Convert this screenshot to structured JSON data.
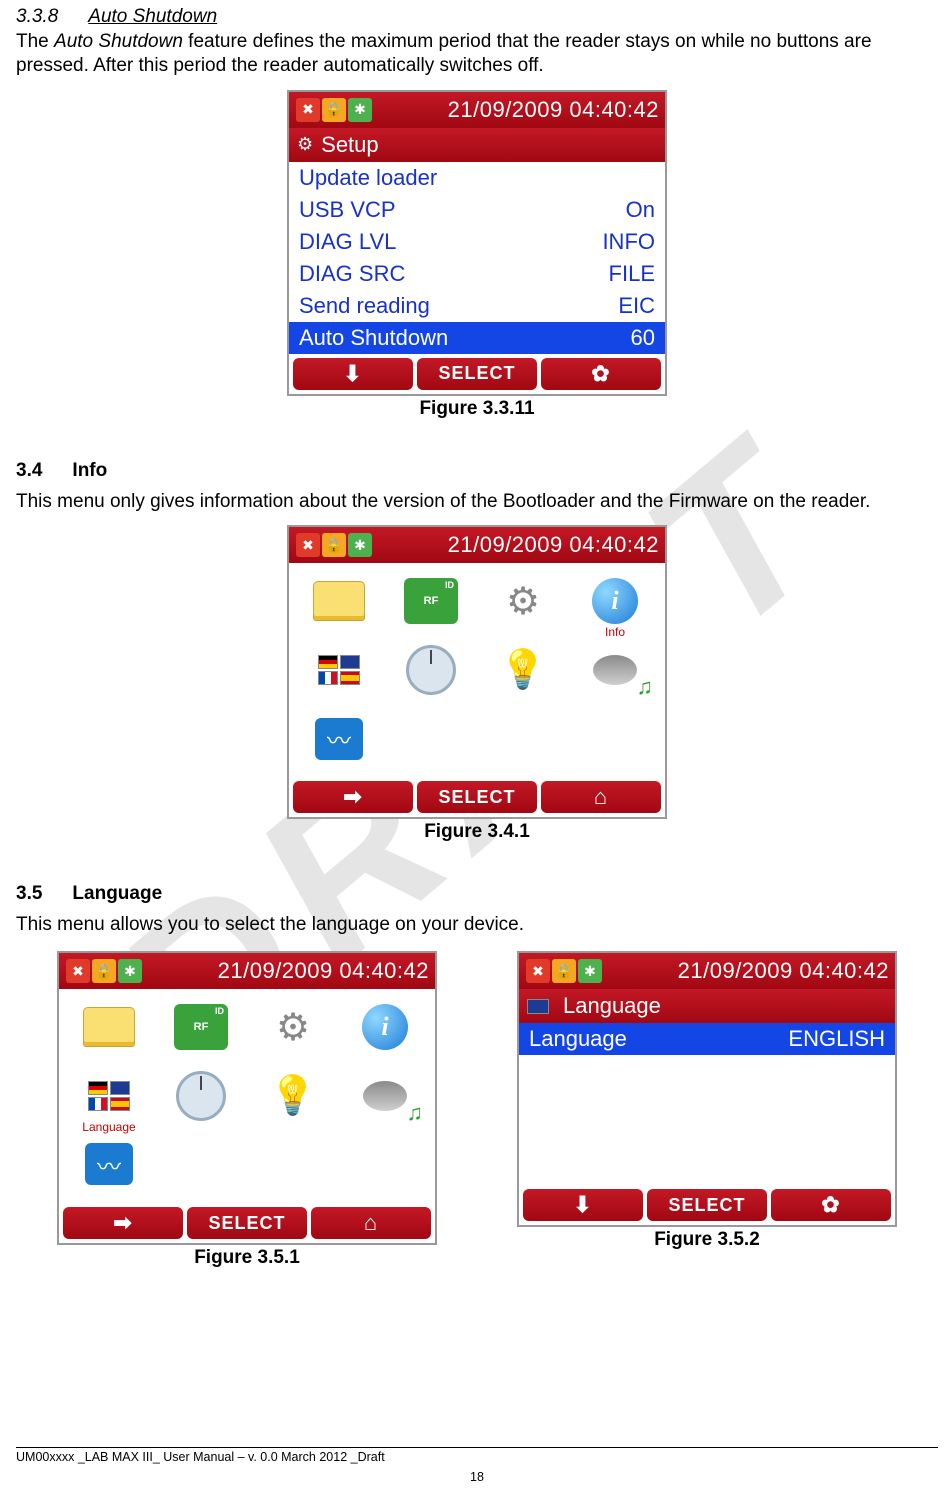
{
  "watermark": "DRAFT",
  "sections": {
    "s338": {
      "num": "3.3.8",
      "title": "Auto Shutdown",
      "para_pre": "The ",
      "para_em": "Auto Shutdown",
      "para_post": " feature defines the maximum period that the reader stays on while no buttons are pressed. After this period the reader automatically switches off."
    },
    "s34": {
      "num": "3.4",
      "title": "Info",
      "para": "This menu only gives information about the version of the Bootloader and the Firmware on the reader."
    },
    "s35": {
      "num": "3.5",
      "title": "Language",
      "para": "This menu allows you to select the language on your device."
    }
  },
  "figcaps": {
    "f3311": "Figure 3.3.11",
    "f341": "Figure 3.4.1",
    "f351": "Figure 3.5.1",
    "f352": "Figure 3.5.2"
  },
  "device": {
    "timestamp": "21/09/2009 04:40:42",
    "setup_label": "Setup",
    "menu": {
      "update_loader": "Update loader",
      "usb_vcp_l": "USB VCP",
      "usb_vcp_v": "On",
      "diag_lvl_l": "DIAG LVL",
      "diag_lvl_v": "INFO",
      "diag_src_l": "DIAG SRC",
      "diag_src_v": "FILE",
      "send_reading_l": "Send reading",
      "send_reading_v": "EIC",
      "auto_shutdown_l": "Auto Shutdown",
      "auto_shutdown_v": "60"
    },
    "soft": {
      "select": "SELECT",
      "down": "⬇",
      "right": "➡",
      "gear": "✿",
      "home": "⌂"
    },
    "grid": {
      "rf": "RF",
      "info_label": "Info",
      "lang_label": "Language"
    },
    "lang_panel": {
      "header": "Language",
      "row_l": "Language",
      "row_v": "ENGLISH"
    }
  },
  "footer": {
    "line": "UM00xxxx _LAB MAX III_ User Manual – v. 0.0 March 2012 _Draft",
    "page": "18"
  }
}
